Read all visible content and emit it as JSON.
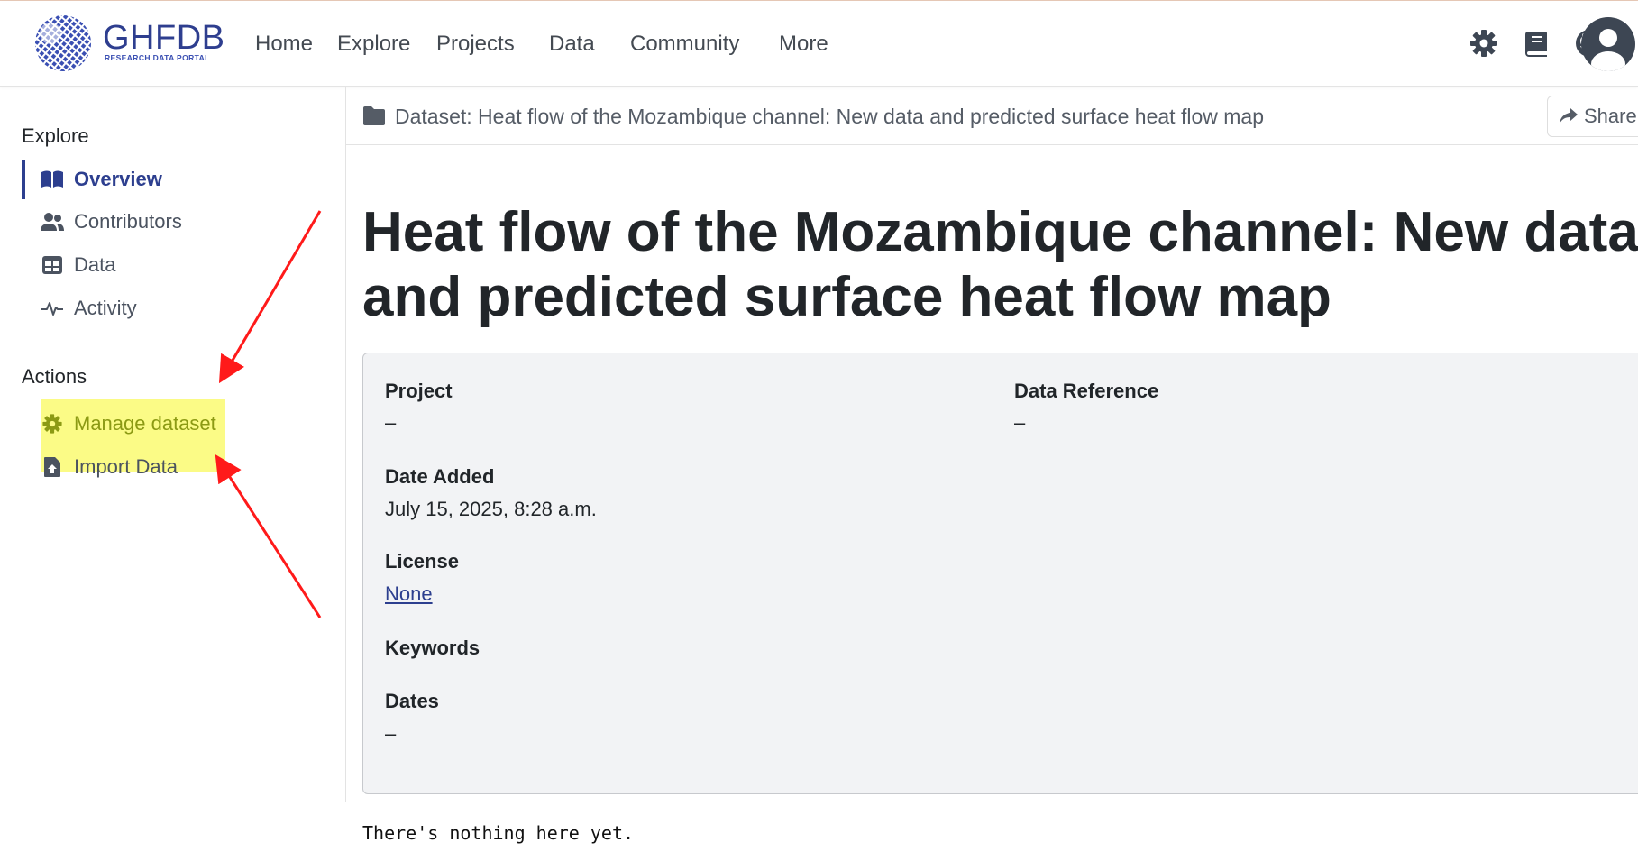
{
  "brand": {
    "name": "GHFDB",
    "subtitle": "RESEARCH DATA PORTAL"
  },
  "nav": {
    "links": [
      "Home",
      "Explore",
      "Projects",
      "Data",
      "Community",
      "More"
    ],
    "icons": [
      "gear-icon",
      "book-icon",
      "github-icon",
      "user-avatar-icon"
    ]
  },
  "sidebar": {
    "explore_heading": "Explore",
    "explore_items": [
      {
        "label": "Overview",
        "icon": "book-open-icon",
        "active": true
      },
      {
        "label": "Contributors",
        "icon": "users-icon",
        "active": false
      },
      {
        "label": "Data",
        "icon": "table-icon",
        "active": false
      },
      {
        "label": "Activity",
        "icon": "pulse-icon",
        "active": false
      }
    ],
    "actions_heading": "Actions",
    "action_items": [
      {
        "label": "Manage dataset",
        "icon": "gear-icon",
        "highlighted": true
      },
      {
        "label": "Import Data",
        "icon": "file-upload-icon",
        "highlighted": false
      }
    ]
  },
  "breadcrumb": {
    "text": "Dataset:  Heat flow of the Mozambique channel: New data and predicted surface heat flow map",
    "icon": "folder-icon"
  },
  "share_label": "Share",
  "title_line1": "Heat flow of the Mozambique channel: New data",
  "title_line2": "and predicted surface heat flow map",
  "details": {
    "project_label": "Project",
    "project_value": "–",
    "data_reference_label": "Data Reference",
    "data_reference_value": "–",
    "date_added_label": "Date Added",
    "date_added_value": "July 15, 2025, 8:28 a.m.",
    "license_label": "License",
    "license_value": "None",
    "keywords_label": "Keywords",
    "dates_label": "Dates",
    "dates_value": "–"
  },
  "empty_message": "There's nothing here yet.",
  "colors": {
    "brand": "#2e3e8f",
    "highlight": "#fbfb86",
    "annotation_arrow": "#ff1a1a",
    "card_bg": "#f2f3f5"
  }
}
